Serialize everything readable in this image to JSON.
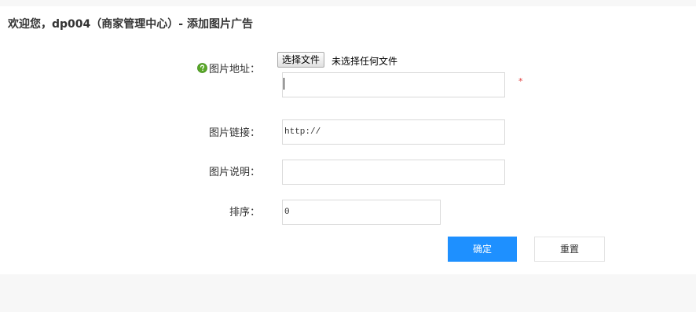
{
  "header": {
    "title": "欢迎您，dp004（商家管理中心）- 添加图片广告"
  },
  "form": {
    "image_address": {
      "label": "图片地址：",
      "file_button": "选择文件",
      "file_status": "未选择任何文件",
      "value": "",
      "required_mark": "*",
      "help_icon": "question-mark-icon"
    },
    "image_link": {
      "label": "图片链接：",
      "value": "http://"
    },
    "image_desc": {
      "label": "图片说明：",
      "value": ""
    },
    "sort": {
      "label": "排序：",
      "value": "0"
    }
  },
  "actions": {
    "confirm_label": "确定",
    "reset_label": "重置"
  },
  "colors": {
    "primary": "#1e90ff",
    "required": "#e03b3b",
    "help_icon": "#5aa829"
  }
}
